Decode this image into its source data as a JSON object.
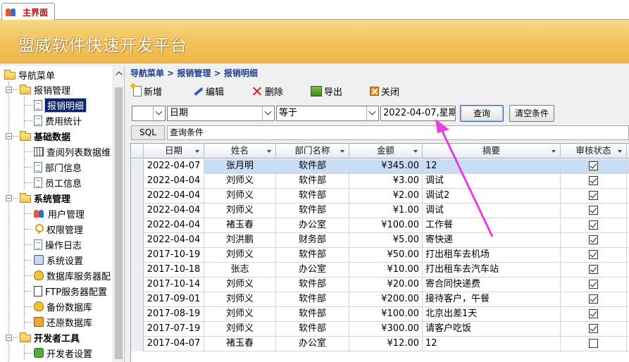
{
  "window": {
    "tab_label": "主界面"
  },
  "banner": {
    "title": "盟威软件快速开发平台"
  },
  "nav": {
    "root": "导航菜单",
    "items": [
      {
        "label": "报销管理",
        "level": 1,
        "bold": false,
        "icon": "folder-icon"
      },
      {
        "label": "报销明细",
        "level": 2,
        "selected": true,
        "icon": "document-icon"
      },
      {
        "label": "费用统计",
        "level": 2,
        "icon": "document-icon"
      },
      {
        "label": "基础数据",
        "level": 1,
        "bold": true,
        "icon": "folder-icon"
      },
      {
        "label": "查阅列表数据维",
        "level": 2,
        "icon": "grid-icon"
      },
      {
        "label": "部门信息",
        "level": 2,
        "icon": "document-icon"
      },
      {
        "label": "员工信息",
        "level": 2,
        "icon": "document-icon"
      },
      {
        "label": "系统管理",
        "level": 1,
        "bold": true,
        "icon": "folder-icon"
      },
      {
        "label": "用户管理",
        "level": 2,
        "icon": "users-icon"
      },
      {
        "label": "权限管理",
        "level": 2,
        "icon": "key-icon"
      },
      {
        "label": "操作日志",
        "level": 2,
        "icon": "document-icon"
      },
      {
        "label": "系统设置",
        "level": 2,
        "icon": "settings-icon"
      },
      {
        "label": "数据库服务器配",
        "level": 2,
        "icon": "database-icon"
      },
      {
        "label": "FTP服务器配置",
        "level": 2,
        "icon": "ftp-icon"
      },
      {
        "label": "备份数据库",
        "level": 2,
        "icon": "database-icon"
      },
      {
        "label": "还原数据库",
        "level": 2,
        "icon": "restore-icon"
      },
      {
        "label": "开发者工具",
        "level": 1,
        "bold": true,
        "icon": "folder-icon"
      },
      {
        "label": "开发者设置",
        "level": 2,
        "icon": "developer-icon"
      }
    ]
  },
  "breadcrumb": "导航菜单 > 报销管理 > 报销明细",
  "toolbar": {
    "new_label": "新增",
    "edit_label": "编辑",
    "delete_label": "删除",
    "export_label": "导出",
    "close_label": "关闭"
  },
  "filter": {
    "logic_value": "",
    "field_value": "日期",
    "operator_value": "等于",
    "value": "2022-04-07,星期",
    "query_label": "查询",
    "clear_label": "清空条件"
  },
  "sql": {
    "label": "SQL",
    "text": "查询条件"
  },
  "grid": {
    "columns": [
      "日期",
      "姓名",
      "部门名称",
      "金额",
      "摘要",
      "审核状态"
    ],
    "rows": [
      {
        "date": "2022-04-07",
        "name": "张月明",
        "dept": "软件部",
        "amount": "¥345.00",
        "summary": "12",
        "audited": true
      },
      {
        "date": "2022-04-04",
        "name": "刘师义",
        "dept": "软件部",
        "amount": "¥3.00",
        "summary": "调试",
        "audited": true
      },
      {
        "date": "2022-04-04",
        "name": "刘师义",
        "dept": "软件部",
        "amount": "¥2.00",
        "summary": "调试2",
        "audited": true
      },
      {
        "date": "2022-04-04",
        "name": "刘师义",
        "dept": "软件部",
        "amount": "¥1.00",
        "summary": "调试",
        "audited": true
      },
      {
        "date": "2022-04-04",
        "name": "褚玉春",
        "dept": "办公室",
        "amount": "¥100.00",
        "summary": "工作餐",
        "audited": true
      },
      {
        "date": "2022-04-04",
        "name": "刘洪鹏",
        "dept": "财务部",
        "amount": "¥5.00",
        "summary": "寄快递",
        "audited": true
      },
      {
        "date": "2017-10-19",
        "name": "刘师义",
        "dept": "软件部",
        "amount": "¥50.00",
        "summary": "打出租车去机场",
        "audited": true
      },
      {
        "date": "2017-10-18",
        "name": "张志",
        "dept": "办公室",
        "amount": "¥10.00",
        "summary": "打出租车去汽车站",
        "audited": true
      },
      {
        "date": "2017-10-14",
        "name": "刘师义",
        "dept": "软件部",
        "amount": "¥20.00",
        "summary": "寄合同快递费",
        "audited": true
      },
      {
        "date": "2017-09-01",
        "name": "刘师义",
        "dept": "软件部",
        "amount": "¥200.00",
        "summary": "接待客户，午餐",
        "audited": true
      },
      {
        "date": "2017-08-19",
        "name": "刘师义",
        "dept": "软件部",
        "amount": "¥100.00",
        "summary": "北京出差1天",
        "audited": true
      },
      {
        "date": "2017-07-19",
        "name": "刘师义",
        "dept": "软件部",
        "amount": "¥300.00",
        "summary": "请客户吃饭",
        "audited": true
      },
      {
        "date": "2017-04-07",
        "name": "褚玉春",
        "dept": "办公室",
        "amount": "¥12.00",
        "summary": "12",
        "audited": false
      }
    ]
  },
  "colors": {
    "accent": "#1e3f8c",
    "banner": "#f3c55e",
    "selected_row": "#c9def5",
    "annotation_arrow": "#e83ce8"
  }
}
